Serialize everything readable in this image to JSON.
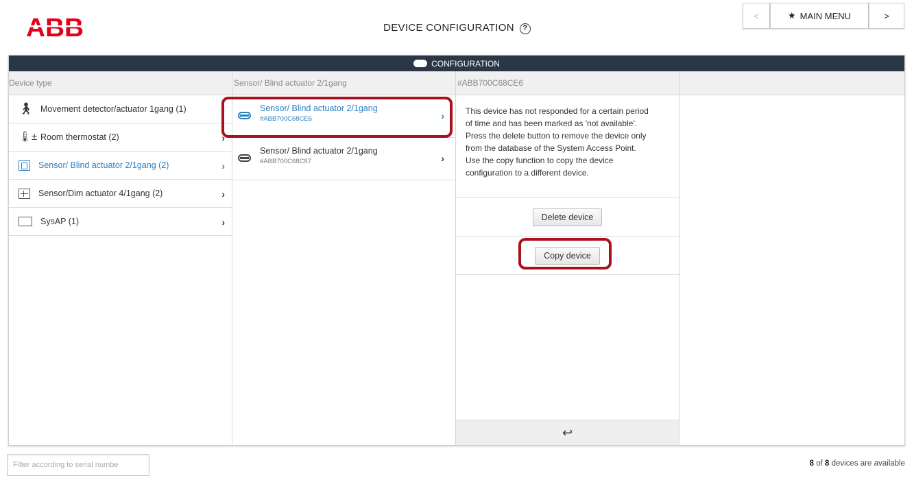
{
  "header": {
    "logo_text": "ABB",
    "title": "DEVICE CONFIGURATION",
    "help_icon": "?",
    "nav_prev": "<",
    "main_menu_label": "MAIN MENU",
    "nav_next": ">"
  },
  "bar": {
    "label": "CONFIGURATION"
  },
  "columns": {
    "device_types_header": "Device type",
    "devices_header": "Sensor/ Blind actuator 2/1gang",
    "detail_header": "#ABB700C68CE6"
  },
  "device_types": [
    {
      "label": "Movement detector/actuator 1gang (1)",
      "icon": "movement-detector-icon"
    },
    {
      "label": "Room thermostat (2)",
      "icon": "thermostat-icon"
    },
    {
      "label": "Sensor/ Blind actuator 2/1gang (2)",
      "icon": "blind-actuator-icon",
      "active": true
    },
    {
      "label": "Sensor/Dim actuator 4/1gang (2)",
      "icon": "dim-actuator-icon"
    },
    {
      "label": "SysAP (1)",
      "icon": "sysap-icon"
    }
  ],
  "devices": [
    {
      "name": "Sensor/ Blind actuator 2/1gang",
      "serial": "#ABB700C68CE6",
      "active": true
    },
    {
      "name": "Sensor/ Blind actuator 2/1gang",
      "serial": "#ABB700C68C87"
    }
  ],
  "detail": {
    "message_lines": [
      "This device has not responded for a certain period",
      "of time and has been marked as 'not available'.",
      "Press the delete button to remove the device only",
      "from the database of the System Access Point.",
      "Use the copy function to copy the device",
      "configuration to a different device."
    ],
    "delete_label": "Delete device",
    "copy_label": "Copy device",
    "back_icon": "↩"
  },
  "footer": {
    "filter_placeholder": "Filter according to serial numbe",
    "status_count": "8",
    "status_of": "of",
    "status_total": "8",
    "status_suffix": "devices are available"
  },
  "colors": {
    "accent": "#2a7fc0",
    "bar": "#2b3646",
    "highlight": "#a8111b",
    "logo": "#e2001a"
  }
}
